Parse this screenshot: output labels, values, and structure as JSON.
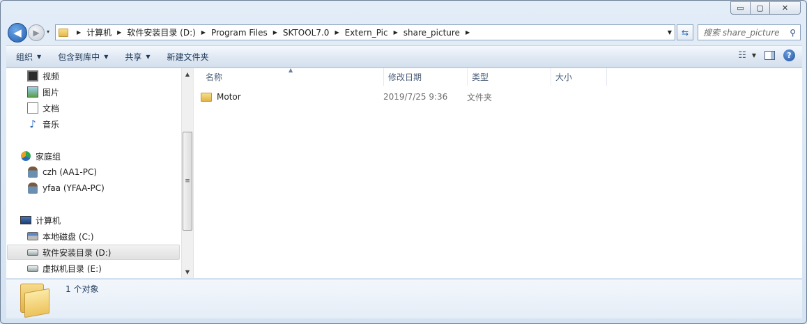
{
  "caption": {
    "minimize": "▭",
    "maximize": "▢",
    "close": "✕"
  },
  "nav": {
    "back": "◀",
    "forward": "▶",
    "dropdown": "▾"
  },
  "breadcrumb": [
    "计算机",
    "软件安装目录 (D:)",
    "Program Files",
    "SKTOOL7.0",
    "Extern_Pic",
    "share_picture"
  ],
  "search": {
    "placeholder": "搜索 share_picture"
  },
  "toolbar": {
    "organize": "组织",
    "include_in_library": "包含到库中",
    "share": "共享",
    "new_folder": "新建文件夹"
  },
  "sidebar": {
    "items": [
      {
        "label": "视频",
        "icon": "video-icon"
      },
      {
        "label": "图片",
        "icon": "picture-icon"
      },
      {
        "label": "文档",
        "icon": "document-icon"
      },
      {
        "label": "音乐",
        "icon": "music-icon"
      },
      {
        "label": "家庭组",
        "icon": "homegroup-icon"
      },
      {
        "label": "czh (AA1-PC)",
        "icon": "user-icon"
      },
      {
        "label": "yfaa (YFAA-PC)",
        "icon": "user-icon"
      },
      {
        "label": "计算机",
        "icon": "computer-icon"
      },
      {
        "label": "本地磁盘 (C:)",
        "icon": "drive-icon"
      },
      {
        "label": "软件安装目录 (D:)",
        "icon": "drive-icon"
      },
      {
        "label": "虚拟机目录 (E:)",
        "icon": "drive-icon"
      }
    ],
    "selected": "软件安装目录 (D:)"
  },
  "columns": [
    "名称",
    "修改日期",
    "类型",
    "大小"
  ],
  "files": [
    {
      "name": "Motor",
      "modified": "2019/7/25 9:36",
      "type": "文件夹",
      "size": ""
    }
  ],
  "details": {
    "count": "1 个对象"
  },
  "colors": {
    "accent": "#1f5cae",
    "folder": "#e4b84a",
    "header_text": "#4c607a"
  }
}
